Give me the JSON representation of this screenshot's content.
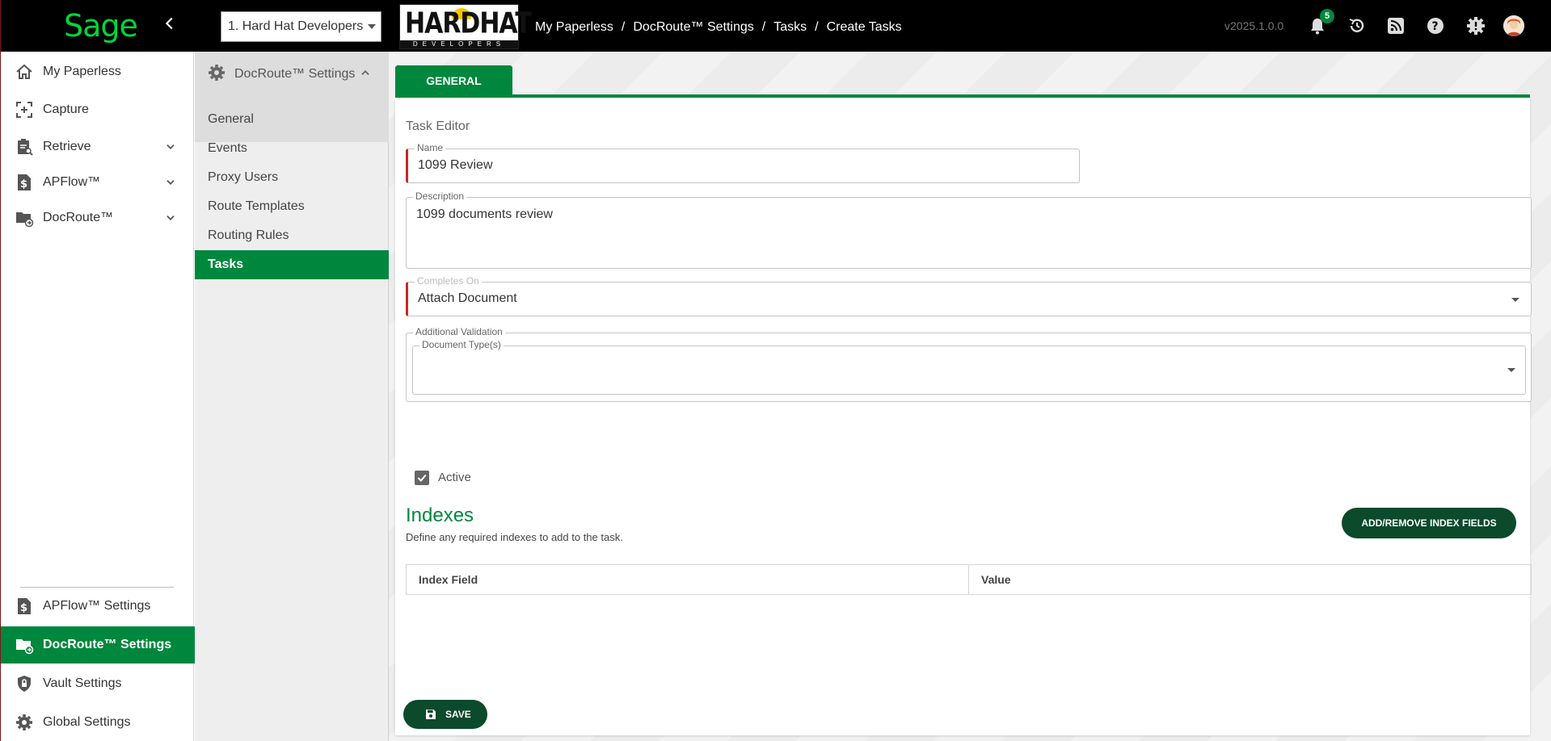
{
  "sidebar": {
    "logo_text": "Sage",
    "collapse_icon": "chevron-left-icon",
    "top_items": [
      {
        "label": "My Paperless",
        "icon": "home-icon"
      },
      {
        "label": "Capture",
        "icon": "capture-icon"
      },
      {
        "label": "Retrieve",
        "icon": "clipboard-search-icon",
        "expandable": true
      },
      {
        "label": "APFlow™",
        "icon": "dollar-doc-icon",
        "expandable": true
      },
      {
        "label": "DocRoute™",
        "icon": "folder-route-icon",
        "expandable": true
      }
    ],
    "bottom_items": [
      {
        "label": "APFlow™ Settings",
        "icon": "dollar-doc-icon"
      },
      {
        "label": "DocRoute™ Settings",
        "icon": "folder-route-icon",
        "active": true
      },
      {
        "label": "Vault Settings",
        "icon": "shield-lock-icon"
      },
      {
        "label": "Global Settings",
        "icon": "gear-icon"
      }
    ]
  },
  "topbar": {
    "company": "1. Hard Hat Developers",
    "company_logo_main": "HARDHAT",
    "company_logo_sub": "DEVELOPERS",
    "breadcrumb": [
      "My Paperless",
      "DocRoute™ Settings",
      "Tasks",
      "Create Tasks"
    ],
    "separator": "/",
    "version": "v2025.1.0.0",
    "notification_count": "5",
    "icons": [
      "bell-icon",
      "history-icon",
      "rss-icon",
      "help-icon",
      "alert-gear-icon",
      "user-avatar-icon"
    ]
  },
  "subpanel": {
    "title": "DocRoute™ Settings",
    "items": [
      "General",
      "Events",
      "Proxy Users",
      "Route Templates",
      "Routing Rules",
      "Tasks"
    ],
    "active_item": "Tasks"
  },
  "main": {
    "tab_label": "GENERAL",
    "section_label": "Task Editor",
    "name": {
      "label": "Name",
      "value": "1099 Review"
    },
    "description": {
      "label": "Description",
      "value": "1099 documents review"
    },
    "completes_on": {
      "label": "Completes On",
      "value": "Attach Document"
    },
    "additional_validation": {
      "label": "Additional Validation",
      "doc_types_label": "Document Type(s)",
      "doc_types_value": ""
    },
    "active": {
      "label": "Active",
      "checked": true
    },
    "indexes": {
      "title": "Indexes",
      "description": "Define any required indexes to add to the task.",
      "button_label": "ADD/REMOVE INDEX FIELDS",
      "columns": [
        "Index Field",
        "Value"
      ]
    },
    "save_label": "SAVE"
  },
  "colors": {
    "brand_green": "#00873e",
    "dark_green": "#0b4a2a",
    "required_red": "#c62828",
    "sage_green": "#00d639"
  }
}
